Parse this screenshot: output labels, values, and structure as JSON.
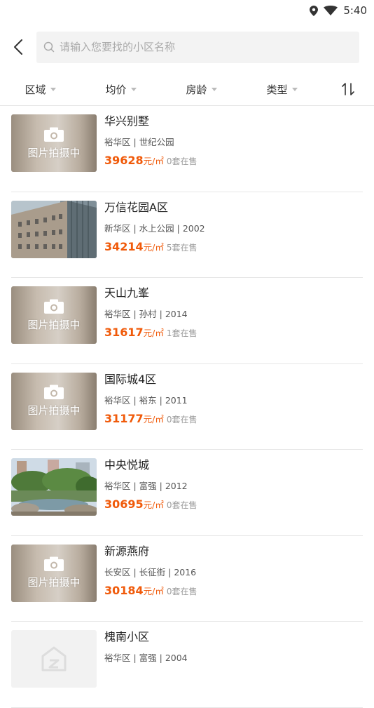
{
  "status": {
    "time": "5:40"
  },
  "search": {
    "placeholder": "请输入您要找的小区名称"
  },
  "filters": [
    "区域",
    "均价",
    "房龄",
    "类型"
  ],
  "pending_label": "图片拍摄中",
  "colors": {
    "accent": "#f05a0a"
  },
  "listings": [
    {
      "name": "华兴别墅",
      "meta": "裕华区 | 世纪公园",
      "price": "39628",
      "unit": "元/㎡",
      "count": "0套在售",
      "image": "pending"
    },
    {
      "name": "万信花园A区",
      "meta": "新华区 | 水上公园 | 2002",
      "price": "34214",
      "unit": "元/㎡",
      "count": "5套在售",
      "image": "building"
    },
    {
      "name": "天山九峯",
      "meta": "裕华区 | 孙村 | 2014",
      "price": "31617",
      "unit": "元/㎡",
      "count": "1套在售",
      "image": "pending"
    },
    {
      "name": "国际城4区",
      "meta": "裕华区 | 裕东 | 2011",
      "price": "31177",
      "unit": "元/㎡",
      "count": "0套在售",
      "image": "pending"
    },
    {
      "name": "中央悦城",
      "meta": "裕华区 | 富强 | 2012",
      "price": "30695",
      "unit": "元/㎡",
      "count": "0套在售",
      "image": "garden"
    },
    {
      "name": "新源燕府",
      "meta": "长安区 | 长征街 | 2016",
      "price": "30184",
      "unit": "元/㎡",
      "count": "0套在售",
      "image": "pending"
    },
    {
      "name": "槐南小区",
      "meta": "裕华区 | 富强 | 2004",
      "price": "",
      "unit": "",
      "count": "",
      "image": "placeholder"
    }
  ]
}
